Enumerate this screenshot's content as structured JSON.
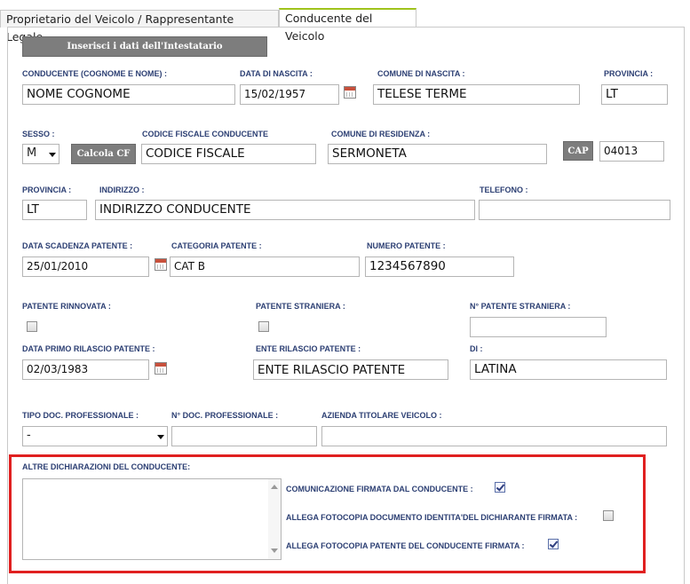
{
  "tabs": [
    {
      "label": "Proprietario del Veicolo / Rappresentante Legale"
    },
    {
      "label": "Conducente del Veicolo"
    }
  ],
  "insert_owner_button": "Inserisci i dati dell'Intestatario",
  "row1": {
    "driver_name_label": "CONDUCENTE (COGNOME E NOME) :",
    "driver_name_value": "NOME COGNOME",
    "birth_date_label": "DATA DI NASCITA :",
    "birth_date_value": "15/02/1957",
    "birth_city_label": "COMUNE DI NASCITA :",
    "birth_city_value": "TELESE TERME",
    "province_label": "PROVINCIA :",
    "province_value": "LT"
  },
  "row2": {
    "sex_label": "SESSO :",
    "sex_value": "M",
    "calc_cf_button": "Calcola CF",
    "tax_code_label": "CODICE FISCALE CONDUCENTE",
    "tax_code_value": "CODICE FISCALE",
    "residence_label": "COMUNE DI RESIDENZA :",
    "residence_value": "SERMONETA",
    "cap_button": "CAP",
    "cap_value": "04013"
  },
  "row3": {
    "province_label": "PROVINCIA :",
    "province_value": "LT",
    "address_label": "INDIRIZZO :",
    "address_value": "INDIRIZZO CONDUCENTE",
    "phone_label": "TELEFONO :",
    "phone_value": ""
  },
  "row4": {
    "license_expiry_label": "DATA SCADENZA PATENTE :",
    "license_expiry_value": "25/01/2010",
    "license_category_label": "CATEGORIA PATENTE :",
    "license_category_value": "CAT B",
    "license_number_label": "NUMERO PATENTE :",
    "license_number_value": "1234567890"
  },
  "row5": {
    "renewed_label": "PATENTE RINNOVATA :",
    "foreign_label": "PATENTE STRANIERA :",
    "foreign_number_label": "N° PATENTE STRANIERA :",
    "foreign_number_value": ""
  },
  "row6": {
    "first_issue_label": "DATA PRIMO RILASCIO PATENTE :",
    "first_issue_value": "02/03/1983",
    "issuer_label": "ENTE RILASCIO PATENTE :",
    "issuer_value": "ENTE RILASCIO PATENTE",
    "of_label": "DI :",
    "of_value": "LATINA"
  },
  "row7": {
    "doc_type_label": "TIPO DOC. PROFESSIONALE :",
    "doc_type_value": "-",
    "doc_number_label": "N° DOC. PROFESSIONALE :",
    "doc_number_value": "",
    "company_label": "AZIENDA TITOLARE VEICOLO :",
    "company_value": ""
  },
  "declarations": {
    "title": "ALTRE DICHIARAZIONI DEL CONDUCENTE:",
    "text": "",
    "signed_label": "COMUNICAZIONE FIRMATA DAL CONDUCENTE :",
    "signed_checked": true,
    "id_copy_label": "ALLEGA FOTOCOPIA DOCUMENTO IDENTITA'DEL DICHIARANTE FIRMATA :",
    "id_copy_checked": false,
    "license_copy_label": "ALLEGA FOTOCOPIA PATENTE DEL CONDUCENTE FIRMATA :",
    "license_copy_checked": true
  },
  "colors": {
    "label": "#2c3f73",
    "highlight": "#e02020",
    "active_tab": "#9fc31b",
    "button": "#7d7d7d"
  }
}
